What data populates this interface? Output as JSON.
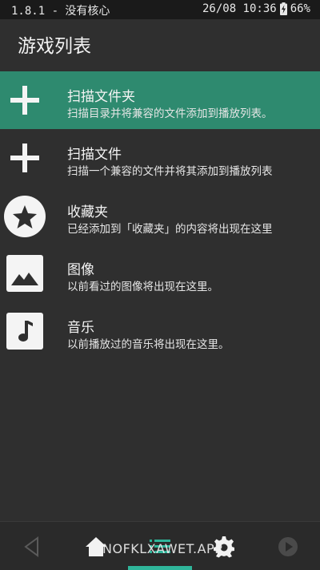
{
  "status_bar": {
    "left_text": "1.8.1 - 没有核心",
    "right_text": "26/08 10:36",
    "battery": "66%",
    "battery_icon": "battery-charging-icon"
  },
  "header": {
    "title": "游戏列表"
  },
  "list": [
    {
      "label": "扫描文件夹",
      "sub": "扫描目录并将兼容的文件添加到播放列表。",
      "icon": "plus-icon",
      "selected": true
    },
    {
      "label": "扫描文件",
      "sub": "扫描一个兼容的文件并将其添加到播放列表",
      "icon": "plus-icon",
      "selected": false
    },
    {
      "label": "收藏夹",
      "sub": "已经添加到「收藏夹」的内容将出现在这里",
      "icon": "star-icon",
      "selected": false
    },
    {
      "label": "图像",
      "sub": "以前看过的图像将出现在这里。",
      "icon": "image-icon",
      "selected": false
    },
    {
      "label": "音乐",
      "sub": "以前播放过的音乐将出现在这里。",
      "icon": "music-note-icon",
      "selected": false
    }
  ],
  "bottom_nav": {
    "items": [
      "back-icon",
      "home-icon",
      "list-icon",
      "gear-icon",
      "play-icon"
    ],
    "active": "list-icon"
  },
  "watermark": "NOFKLXAWET.APP",
  "colors": {
    "accent": "#2e8a6f",
    "indicator": "#2fb59a",
    "background": "#2f2f2f"
  }
}
